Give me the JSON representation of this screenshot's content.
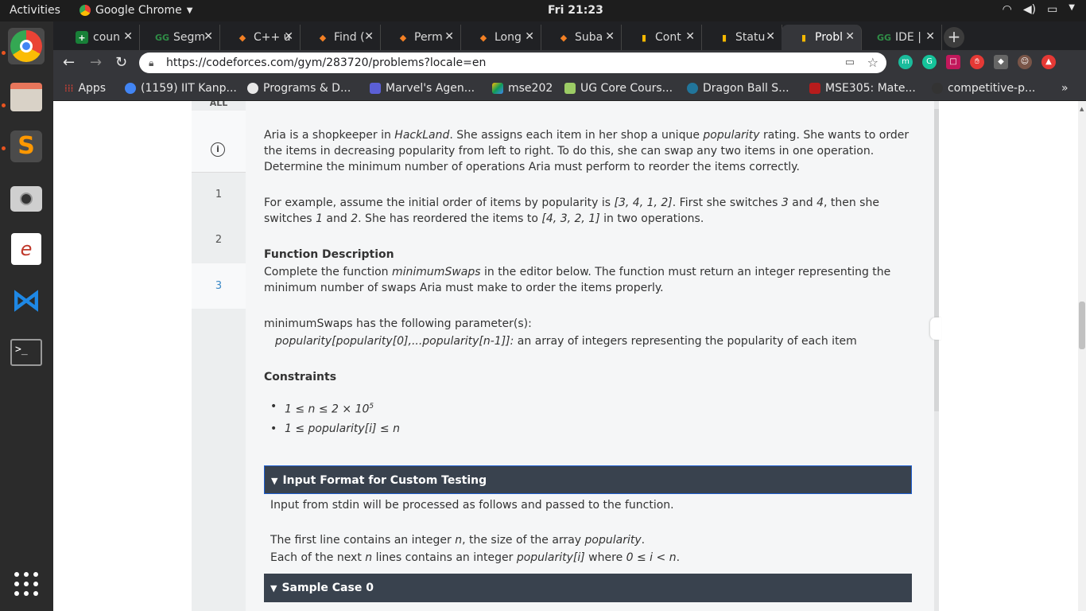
{
  "topbar": {
    "activities": "Activities",
    "app": "Google Chrome",
    "clock": "Fri 21:23"
  },
  "tabs": [
    {
      "label": "coun",
      "fav": "+",
      "color": "#188038"
    },
    {
      "label": "Segm",
      "fav": "GG",
      "color": "#2f8d46"
    },
    {
      "label": "C++ u",
      "fav": "◆",
      "color": "#f48024"
    },
    {
      "label": "Find (",
      "fav": "◆",
      "color": "#f48024"
    },
    {
      "label": "Perm",
      "fav": "◆",
      "color": "#f48024"
    },
    {
      "label": "Long",
      "fav": "◆",
      "color": "#f48024"
    },
    {
      "label": "Suba",
      "fav": "◆",
      "color": "#f48024"
    },
    {
      "label": "Cont",
      "fav": "▮",
      "color": "#f5b800"
    },
    {
      "label": "Statu",
      "fav": "▮",
      "color": "#f5b800"
    },
    {
      "label": "Probl",
      "fav": "▮",
      "color": "#f5b800"
    },
    {
      "label": "IDE |",
      "fav": "GG",
      "color": "#2f8d46"
    }
  ],
  "address": {
    "url": "https://codeforces.com/gym/283720/problems?locale=en"
  },
  "bookmarks": [
    {
      "label": "Apps",
      "color": "#ea4335"
    },
    {
      "label": "(1159) IIT Kanp...",
      "color": "#4285f4"
    },
    {
      "label": "Programs & D...",
      "color": "#e8e8e8"
    },
    {
      "label": "Marvel's Agen...",
      "color": "#5b5fd6"
    },
    {
      "label": "mse202",
      "color": "#0f9d58"
    },
    {
      "label": "UG Core Cours...",
      "color": "#9ccc65"
    },
    {
      "label": "Dragon Ball S...",
      "color": "#21759b"
    },
    {
      "label": "MSE305: Mate...",
      "color": "#b71c1c"
    },
    {
      "label": "competitive-p...",
      "color": "#333"
    }
  ],
  "sidenav": {
    "all": "ALL",
    "items": [
      "1",
      "2",
      "3"
    ]
  },
  "problem": {
    "p1_a": "Aria is a shopkeeper in ",
    "p1_b": "HackLand",
    "p1_c": ". She assigns each item in her shop a unique ",
    "p1_d": "popularity",
    "p1_e": " rating. She wants to order the items in decreasing popularity from left to right. To do this, she can swap any two items in one operation. Determine the minimum number of operations Aria must perform to reorder the items correctly.",
    "p2_a": "For example, assume the initial order of items by popularity is ",
    "p2_b": "[3, 4, 1, 2]",
    "p2_c": ". First she switches ",
    "p2_d": "3",
    "p2_e": " and ",
    "p2_f": "4",
    "p2_g": ", then she switches ",
    "p2_h": "1",
    "p2_i": " and ",
    "p2_j": "2",
    "p2_k": ". She has reordered the items to ",
    "p2_l": "[4, 3, 2, 1]",
    "p2_m": " in two operations.",
    "fd_title": "Function Description",
    "fd_a": "Complete the function ",
    "fd_b": "minimumSwaps",
    "fd_c": " in the editor below. The function must return an integer representing the minimum number of swaps Aria must make to order the items properly.",
    "params_title": "minimumSwaps has the following parameter(s):",
    "param_name": "popularity[popularity[0],...popularity[n-1]]:",
    "param_desc": "  an array of integers representing the popularity of each item",
    "cons_title": "Constraints",
    "cons1": "1 ≤ n ≤ 2 × 10",
    "cons1_sup": "5",
    "cons2": "1 ≤ popularity[i] ≤ n",
    "input_title": "Input Format for Custom Testing",
    "input_1": "Input from stdin will be processed as follows and passed to the function.",
    "input_2a": "The first line contains an integer ",
    "input_2b": "n",
    "input_2c": ", the size of the array ",
    "input_2d": "popularity",
    "input_2e": ".",
    "input_3a": "Each of the next ",
    "input_3b": "n",
    "input_3c": " lines contains an integer ",
    "input_3d": "popularity[i]",
    "input_3e": " where ",
    "input_3f": "0 ≤ i < n",
    "input_3g": ".",
    "sample_title": "Sample Case 0"
  }
}
